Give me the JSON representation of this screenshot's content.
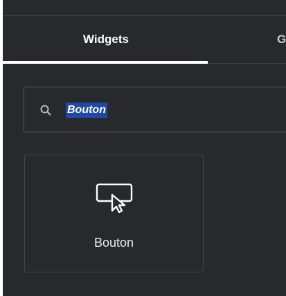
{
  "tabs": [
    {
      "label": "Widgets"
    },
    {
      "label": "G"
    }
  ],
  "search": {
    "value": "Bouton",
    "icon": "search-icon"
  },
  "widgets": [
    {
      "label": "Bouton",
      "icon": "button-cursor-icon"
    }
  ],
  "colors": {
    "panel_background": "#27292d",
    "selection_highlight": "#1f48a8",
    "border": "#565a61",
    "text": "#ffffff"
  }
}
